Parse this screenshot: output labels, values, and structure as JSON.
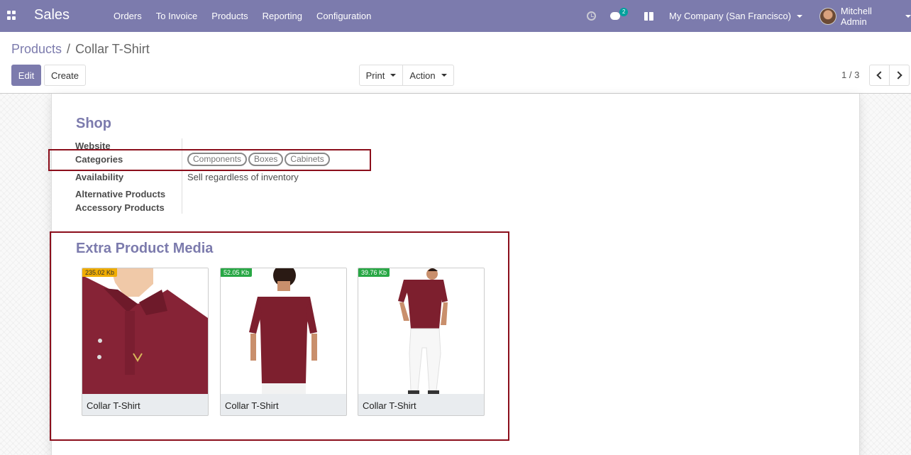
{
  "navbar": {
    "app_name": "Sales",
    "menu": [
      "Orders",
      "To Invoice",
      "Products",
      "Reporting",
      "Configuration"
    ],
    "chat_count": "2",
    "company": "My Company (San Francisco)",
    "user": "Mitchell Admin",
    "bg_color": "#7c7bad"
  },
  "breadcrumb": {
    "parent": "Products",
    "separator": "/",
    "current": "Collar T-Shirt"
  },
  "toolbar": {
    "edit": "Edit",
    "create": "Create",
    "print": "Print",
    "action": "Action"
  },
  "pager": {
    "value": "1 / 3"
  },
  "shop": {
    "title": "Shop",
    "fields": {
      "website": "Website",
      "categories": "Categories",
      "availability": "Availability",
      "availability_value": "Sell regardless of inventory",
      "alternative": "Alternative Products",
      "accessory": "Accessory Products"
    },
    "categories": [
      "Components",
      "Boxes",
      "Cabinets"
    ]
  },
  "media": {
    "title": "Extra Product Media",
    "items": [
      {
        "size": "235.02 Kb",
        "name": "Collar T-Shirt"
      },
      {
        "size": "52.05 Kb",
        "name": "Collar T-Shirt"
      },
      {
        "size": "39.76 Kb",
        "name": "Collar T-Shirt"
      }
    ]
  }
}
